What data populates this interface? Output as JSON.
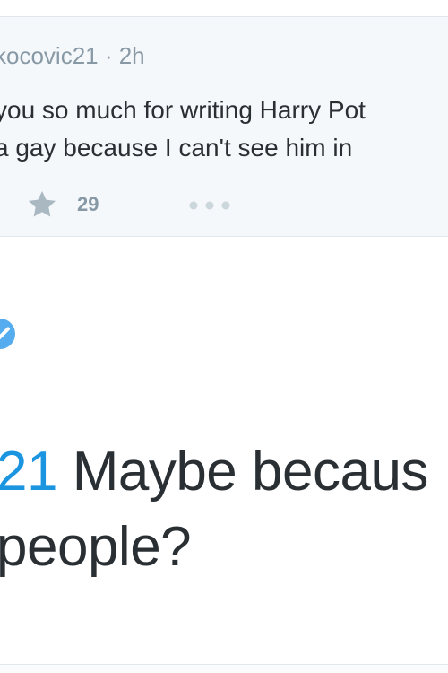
{
  "quoted_tweet": {
    "meta": "kocovic21 · 2h",
    "text_line1": "you so much for writing Harry Pot",
    "text_line2": "a gay because I can't see him in",
    "favorite_count": "29",
    "icons": {
      "favorite": "star-icon",
      "more": "more-icon"
    }
  },
  "reply_tweet": {
    "icons": {
      "verified": "verified-badge-icon"
    },
    "mention": "21",
    "text_line1_rest": " Maybe becaus",
    "text_line2": "people?"
  },
  "colors": {
    "card_background": "#f5f8fa",
    "muted_text": "#8899a6",
    "body_text": "#292f33",
    "mention_blue": "#1b95e0",
    "verified_blue": "#55acee",
    "divider": "#e1e8ed"
  }
}
